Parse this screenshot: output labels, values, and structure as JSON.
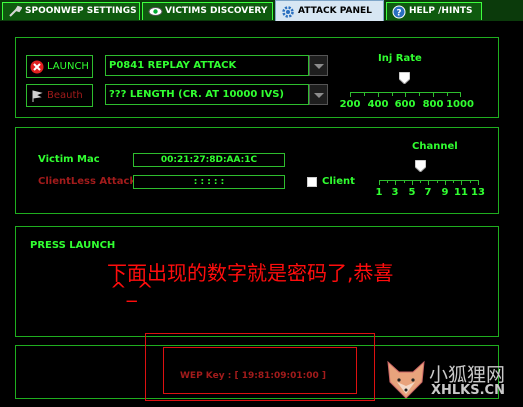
{
  "tabs": [
    {
      "label": "SPOONWEP SETTINGS",
      "icon": "wrench-icon",
      "active": false
    },
    {
      "label": "VICTIMS DISCOVERY",
      "icon": "eye-icon",
      "active": false
    },
    {
      "label": "ATTACK PANEL",
      "icon": "gear-icon",
      "active": true
    },
    {
      "label": "HELP /HINTS",
      "icon": "help-icon",
      "active": false
    }
  ],
  "attack": {
    "launch_label": "LAUNCH",
    "beauth_label": "Beauth",
    "attack_mode": "P0841 REPLAY ATTACK",
    "length_mode": "??? LENGTH (CR. AT 10000 IVS)",
    "inj_rate_label": "Inj Rate",
    "inj_rate_ticks": [
      "200",
      "400",
      "600",
      "800",
      "1000"
    ],
    "inj_rate_value": "600"
  },
  "victim": {
    "mac_label": "Victim Mac",
    "mac_value": "00:21:27:8D:AA:1C",
    "clientless_label": "ClientLess Attack",
    "clientless_value": ": : : : :",
    "client_label": "Client",
    "channel_label": "Channel",
    "channel_ticks": [
      "1",
      "3",
      "5",
      "7",
      "9",
      "11",
      "13"
    ],
    "channel_value": "6"
  },
  "status": {
    "message": "PRESS LAUNCH",
    "overlay_line1": "下面出现的数字就是密码了,恭喜",
    "overlay_line2": "^_^"
  },
  "result": {
    "wep_key": "WEP Key : [ 19:81:09:01:00 ]"
  },
  "watermark": {
    "title": "小狐狸网",
    "url": "XHLKS.CN"
  },
  "colors": {
    "accent_green": "#31ff31",
    "panel_border": "#1fae1f",
    "dark_red": "#a21b1b",
    "overlay_red": "#ff0d0d"
  }
}
